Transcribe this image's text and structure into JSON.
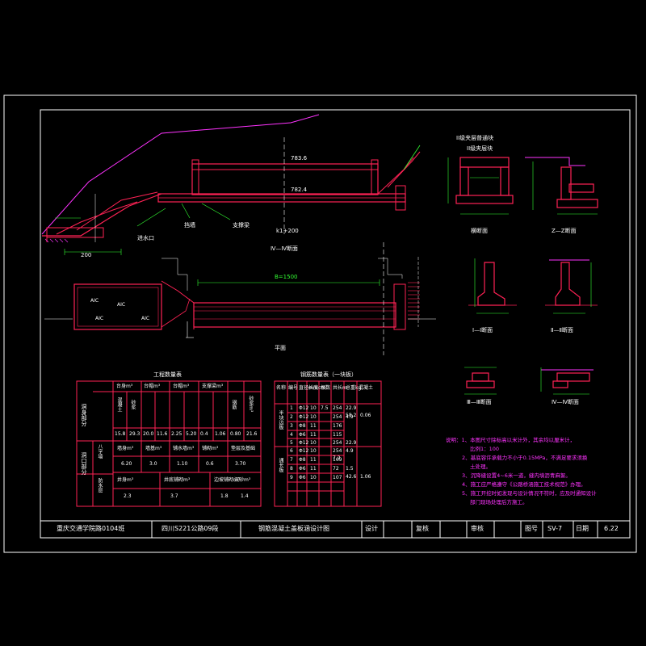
{
  "views": {
    "elevation_label": "Ⅳ—Ⅳ断面",
    "plan_label": "平面",
    "cross_section_label": "横断面",
    "section_z": "Z—Z断面",
    "section_1": "Ⅰ—Ⅰ断面",
    "section_2": "Ⅱ—Ⅱ断面",
    "section_3": "Ⅲ—Ⅲ断面",
    "section_4": "Ⅳ—Ⅳ断面",
    "elev_top": "783.6",
    "elev_bottom": "782.4",
    "station": "k1+200",
    "dim_200": "200",
    "dim_1500": "B=1500",
    "label_inlet": "进水口",
    "label_outlet": "支撑梁",
    "label_wall": "挡墙",
    "cs_top_label": "II级夹层普通块",
    "cs_top_label2": "II级夹层块",
    "aic_1": "AIC",
    "aic_2": "AIC",
    "aic_3": "AIC",
    "aic_4": "AIC"
  },
  "table1": {
    "title": "工程数量表",
    "header_col0": "洞身部分",
    "col_groups": [
      "台身m³",
      "台帽m³",
      "台帽m³",
      "支撑梁m³"
    ],
    "sub_a": "混凝土",
    "sub_b": "砂浆",
    "col_extra1": "钢筋",
    "col_extra2": "砂浆m³",
    "row1": [
      "15.8",
      "29.3",
      "20.0",
      "11.6",
      "2.25",
      "5.20",
      "0.4",
      "1.06",
      "0.80",
      "21.6"
    ],
    "section2": "洞口部分",
    "row2_label_a": "八字墙",
    "row2_label_b": "防水层",
    "row2_cells": [
      "墙身m³",
      "墙基m³",
      "铺水墙m³",
      "铺砌m³",
      "垫层及基础"
    ],
    "row2_vals": [
      "6.20",
      "3.0",
      "1.10",
      "0.6",
      "3.70"
    ],
    "row3_cells": [
      "井身m³",
      "井底铺砌m³",
      "边坡铺砌m³",
      "沉砂m³"
    ],
    "row3_vals": [
      "2.3",
      "3.7",
      "1.8",
      "1.4"
    ]
  },
  "table2": {
    "title": "钢筋数量表（一块板）",
    "headers": [
      "名称",
      "编号",
      "直径mm",
      "长度cm",
      "根数",
      "共长m",
      "总重kg",
      "混凝土"
    ],
    "group1": "半块边板",
    "group2": "通长板",
    "rows": [
      [
        "1",
        "Φ12",
        "10",
        "7.5",
        "254",
        "22.9"
      ],
      [
        "2",
        "Φ12",
        "10",
        "",
        "254",
        "4.9"
      ],
      [
        "3",
        "Φ8",
        "11",
        "",
        "176",
        ""
      ],
      [
        "4",
        "Φ6",
        "11",
        "",
        "115",
        ""
      ],
      [
        "5",
        "Φ12",
        "10",
        "",
        "254",
        "22.9"
      ],
      [
        "6",
        "Φ12",
        "10",
        "",
        "254",
        "4.9"
      ],
      [
        "7",
        "Φ8",
        "11",
        "",
        "169",
        ""
      ],
      [
        "8",
        "Φ6",
        "11",
        "",
        "72",
        "1.5"
      ],
      [
        "9",
        "Φ6",
        "10",
        "",
        "107",
        ""
      ]
    ],
    "totals": [
      "7.2",
      "58.2",
      "0.06",
      "42.6",
      "1.06"
    ]
  },
  "notes": {
    "head": "说明：1、本图尺寸除标高以米计外，其余均以厘米计，",
    "l1": "比例1：100",
    "l2": "2、基底容许承载力不小于0.15MPa，不满足要求须换",
    "l2b": "土处理。",
    "l3": "3、沉降缝设置4~6米一道，缝内填沥青麻絮。",
    "l4": "4、施工应严格遵守《公路桥涵施工技术规范》办理。",
    "l5": "5、施工开挖时如发现与设计情况不符时，应及时通知设计",
    "l5b": "部门现场处理后方施工。"
  },
  "title_block": {
    "org": "重庆交通学院路0104班",
    "project": "四川S221公路09段",
    "drawing": "钢筋混凝土盖板涵设计图",
    "design": "设计",
    "check": "复核",
    "review": "审核",
    "no_label": "图号",
    "no": "SV-7",
    "date_label": "日期",
    "date": "6.22"
  },
  "colors": {
    "frame": "#ffffff",
    "structure": "#ff2255",
    "dimension": "#33ff33",
    "notes": "#ff33ff",
    "ground": "#ff33ff",
    "background": "#000000"
  }
}
